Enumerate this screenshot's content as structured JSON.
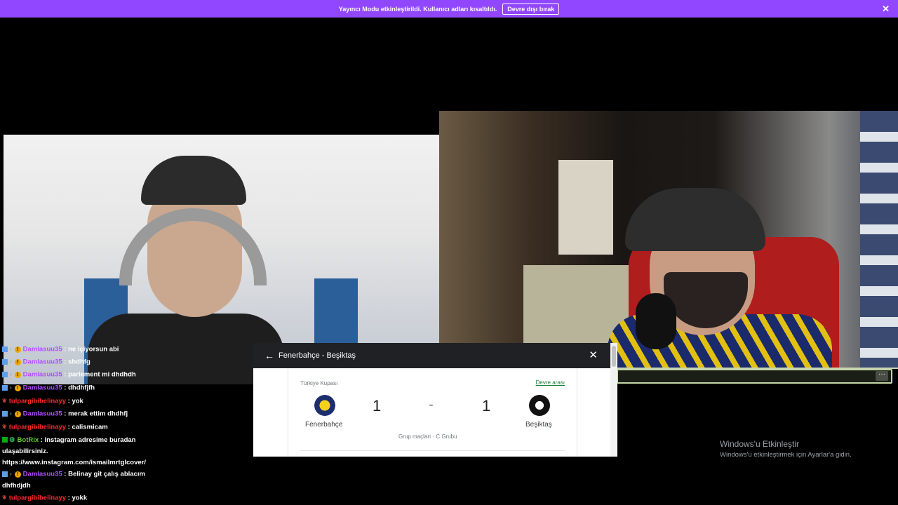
{
  "banner": {
    "message": "Yayıncı Modu etkinleştirildi. Kullanıcı adları kısaltıldı.",
    "button_label": "Devre dışı bırak",
    "close_icon": "close-icon"
  },
  "chat": {
    "messages": [
      {
        "user": "Damlasuu35",
        "text": ": ne içiyorsun abi",
        "color": "#b34dff"
      },
      {
        "user": "Damlasuu35",
        "text": ": shdhfg",
        "color": "#b34dff"
      },
      {
        "user": "Damlasuu35",
        "text": ": parlement mi dhdhdh",
        "color": "#b34dff"
      },
      {
        "user": "Damlasuu35",
        "text": ": dhdhfjfh",
        "color": "#b34dff"
      },
      {
        "user": "tulpargibibelinayy",
        "text": ": yok",
        "color": "#ff2b2b"
      },
      {
        "user": "Damlasuu35",
        "text": ": merak ettim dhdhfj",
        "color": "#b34dff"
      },
      {
        "user": "tulpargibibelinayy",
        "text": ": calismicam",
        "color": "#ff2b2b"
      },
      {
        "user": "BotRix",
        "text": ": Instagram adresime buradan ulaşabilirsiniz. https://www.instagram.com/ismailmrtglcover/",
        "color": "#5ad22f"
      },
      {
        "user": "Damlasuu35",
        "text": ": Belinay git çalış ablacım dhfhdjdh",
        "color": "#b34dff"
      },
      {
        "user": "tulpargibibelinayy",
        "text": ": yokk",
        "color": "#ff2b2b"
      }
    ]
  },
  "match": {
    "title": "Fenerbahçe - Beşiktaş",
    "league": "Türkiye Kupası",
    "status": "Devre arası",
    "home_team": "Fenerbahçe",
    "away_team": "Beşiktaş",
    "home_score": "1",
    "away_score": "1",
    "separator": "-",
    "group": "Grup maçları · C Grubu"
  },
  "watermark": {
    "title": "Windows'u Etkinleştir",
    "subtitle": "Windows'u etkinleştirmek için Ayarlar'a gidin."
  },
  "green_bar": {
    "more_label": "···"
  }
}
